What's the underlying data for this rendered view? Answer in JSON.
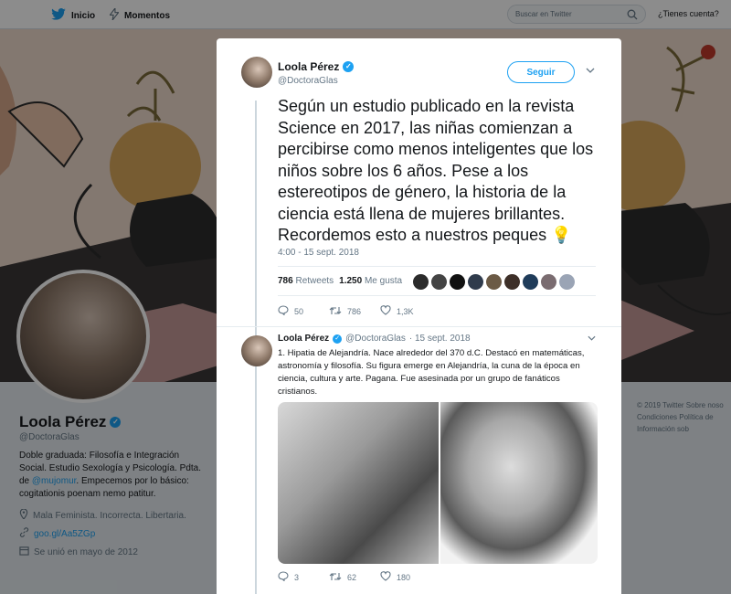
{
  "nav": {
    "home_label": "Inicio",
    "moments_label": "Momentos",
    "search_placeholder": "Buscar en Twitter",
    "account_label": "¿Tienes cuenta?"
  },
  "profile": {
    "name": "Loola Pérez",
    "handle": "@DoctoraGlas",
    "bio_part1": "Doble graduada: Filosofía e Integración Social. Estudio Sexología y Psicología. Pdta. de ",
    "bio_link": "@mujomur",
    "bio_part2": ". Empecemos por lo básico: cogitationis poenam nemo patitur.",
    "location": "Mala Feminista. Incorrecta. Libertaria.",
    "url": "goo.gl/Aa5ZGp",
    "joined": "Se unió en mayo de 2012"
  },
  "footer": {
    "line1": "© 2019 Twitter   Sobre noso",
    "line2": "Condiciones   Política de",
    "line3": "Información sob"
  },
  "tweet": {
    "name": "Loola Pérez",
    "handle": "@DoctoraGlas",
    "follow_label": "Seguir",
    "text": "Según un estudio publicado en la revista Science en 2017, las niñas comienzan a percibirse como menos inteligentes que los niños sobre los 6 años. Pese a los estereotipos de género, la historia de la ciencia está llena de mujeres brillantes. Recordemos esto a nuestros peques 💡",
    "date": "4:00 - 15 sept. 2018",
    "retweets_count": "786",
    "retweets_label": "Retweets",
    "likes_count": "1.250",
    "likes_label": "Me gusta",
    "liker_colors": [
      "#2b2b2b",
      "#444444",
      "#111111",
      "#2f3b4c",
      "#6b5a45",
      "#3d2f28",
      "#1f3c5a",
      "#7a6c70",
      "#9aa4b5"
    ],
    "replies": "50",
    "retweets": "786",
    "likes": "1,3K"
  },
  "reply": {
    "name": "Loola Pérez",
    "handle": "@DoctoraGlas",
    "date": "· 15 sept. 2018",
    "text": "1. Hipatia de Alejandría. Nace alrededor del 370 d.C. Destacó en matemáticas, astronomía y filosofía. Su figura emerge en Alejandría, la cuna de la época en ciencia, cultura y arte. Pagana. Fue asesinada por un grupo de fanáticos cristianos.",
    "replies": "3",
    "retweets": "62",
    "likes": "180"
  },
  "colors": {
    "accent": "#1da1f2",
    "banner": "#efdacd"
  },
  "icons": [
    "twitter-bird-icon",
    "lightning-icon",
    "search-icon",
    "verified-icon",
    "chevron-down-icon",
    "reply-icon",
    "retweet-icon",
    "heart-icon",
    "location-icon",
    "link-icon",
    "calendar-icon"
  ]
}
